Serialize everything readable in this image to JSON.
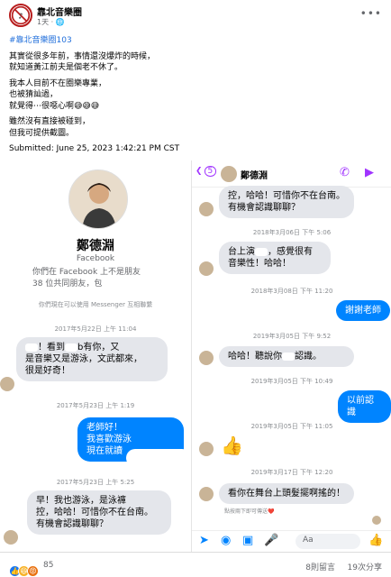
{
  "header": {
    "group_name": "靠北音樂圈",
    "meta": "1天 · ",
    "globe": "🌐",
    "more": "•••"
  },
  "post": {
    "hashtag": "#靠北音樂圈103",
    "paragraphs": [
      [
        "其實從很多年前，事情還沒爆炸的時候，",
        "就知道黃江前夫是個老不休了。"
      ],
      [
        "我本人目前不在圈樂專業，",
        "也被猜訕過，",
        "就覺得⋯很噁心啊😅😅😅"
      ],
      [
        "雖然沒有直接被碰到，",
        "但我可提供截圖。"
      ]
    ],
    "submitted": "Submitted:  June 25, 2023 1:42:21 PM CST"
  },
  "left_chat": {
    "profile_name": "鄭德淵",
    "profile_sub": "Facebook",
    "info_line1": "你們在 Facebook 上不是朋友",
    "info_line2": "38 位共同朋友，包",
    "note": "你們現在可以使用 Messenger 互相聯繫",
    "ts1": "2017年5月22日 上午 11:04",
    "msg1_line1": "！看到",
    "msg1_line1b": "b有你，又",
    "msg1_line2": "是音樂又是游泳，文武都來，",
    "msg1_line3": "很是好奇！",
    "ts2": "2017年5月23日 上午 1:19",
    "out1_line1": "老師好！",
    "out1_line2": "我喜歡游泳",
    "out1_line3": "現在就讀",
    "ts3": "2017年5月23日 上午 5:25",
    "msg2_line1": "早！我也游泳，是泳褲",
    "msg2_line2": "控，哈哈！可惜你不在台南。",
    "msg2_line3": "有機會認識聊聊？"
  },
  "right_chat": {
    "back_count": "5",
    "name": "鄭德淵",
    "msg0_line1": "控，哈哈！可惜你不在台南。",
    "msg0_line2": "有機會認識聊聊？",
    "ts1": "2018年3月06日 下午 5:06",
    "msg1_line1": "台上演",
    "msg1_line1b": "，感覺很有",
    "msg1_line2": "音樂性！哈哈！",
    "ts2": "2018年3月08日 下午 11:20",
    "out1": "謝謝老師",
    "ts3": "2019年3月05日 下午 9:52",
    "msg2": "哈哈！聽說你",
    "msg2b": "認識。",
    "ts4": "2019年3月05日 下午 10:49",
    "out2": "以前認識",
    "ts5": "2019年3月05日 下午 11:05",
    "ts6": "2019年3月17日 下午 12:20",
    "msg3": "看你在舞台上頭髮擺啊搖的！",
    "hint": "點按兩下即可傳送❤️",
    "composer_placeholder": "Aa"
  },
  "footer": {
    "reactions": "85",
    "comments": "8則留言",
    "shares": "19次分享"
  }
}
